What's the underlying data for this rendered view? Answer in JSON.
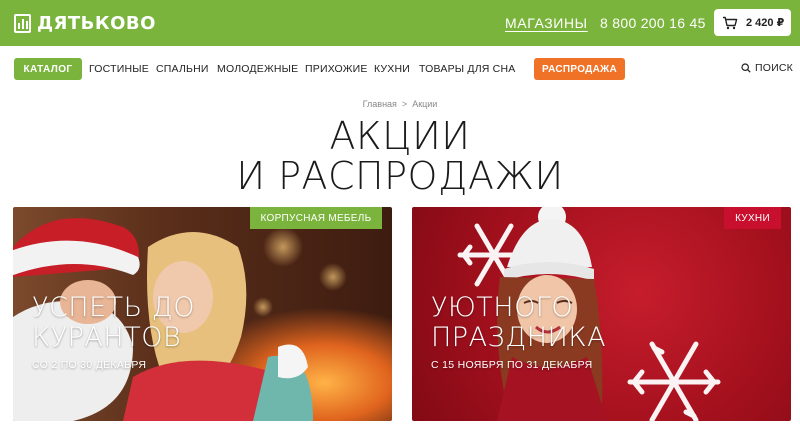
{
  "header": {
    "logo_text": "ДЯТЬКОВО",
    "stores_link": "МАГАЗИНЫ",
    "phone": "8 800 200 16 45",
    "cart_total": "2 420 ₽",
    "brand_color": "#7ab43c"
  },
  "nav": {
    "catalog_label": "КАТАЛОГ",
    "items": [
      "ГОСТИНЫЕ",
      "СПАЛЬНИ",
      "МОЛОДЕЖНЫЕ",
      "ПРИХОЖИЕ",
      "КУХНИ",
      "ТОВАРЫ ДЛЯ СНА"
    ],
    "sale_label": "РАСПРОДАЖА",
    "sale_color": "#ef7227",
    "search_label": "ПОИСК"
  },
  "breadcrumb": {
    "home": "Главная",
    "separator": ">",
    "current": "Акции"
  },
  "page": {
    "title_line1": "АКЦИИ",
    "title_line2": "И РАСПРОДАЖИ"
  },
  "promos": [
    {
      "tag": "КОРПУСНАЯ МЕБЕЛЬ",
      "title_line1": "УСПЕТЬ ДО",
      "title_line2": "КУРАНТОВ",
      "dates": "СО 2 ПО 30 ДЕКАБРЯ"
    },
    {
      "tag": "КУХНИ",
      "title_line1": "УЮТНОГО",
      "title_line2": "ПРАЗДНИКА",
      "dates": "С 15 НОЯБРЯ ПО 31 ДЕКАБРЯ"
    }
  ],
  "icons": {
    "logo": "building-icon",
    "cart": "cart-icon",
    "search": "search-icon"
  }
}
